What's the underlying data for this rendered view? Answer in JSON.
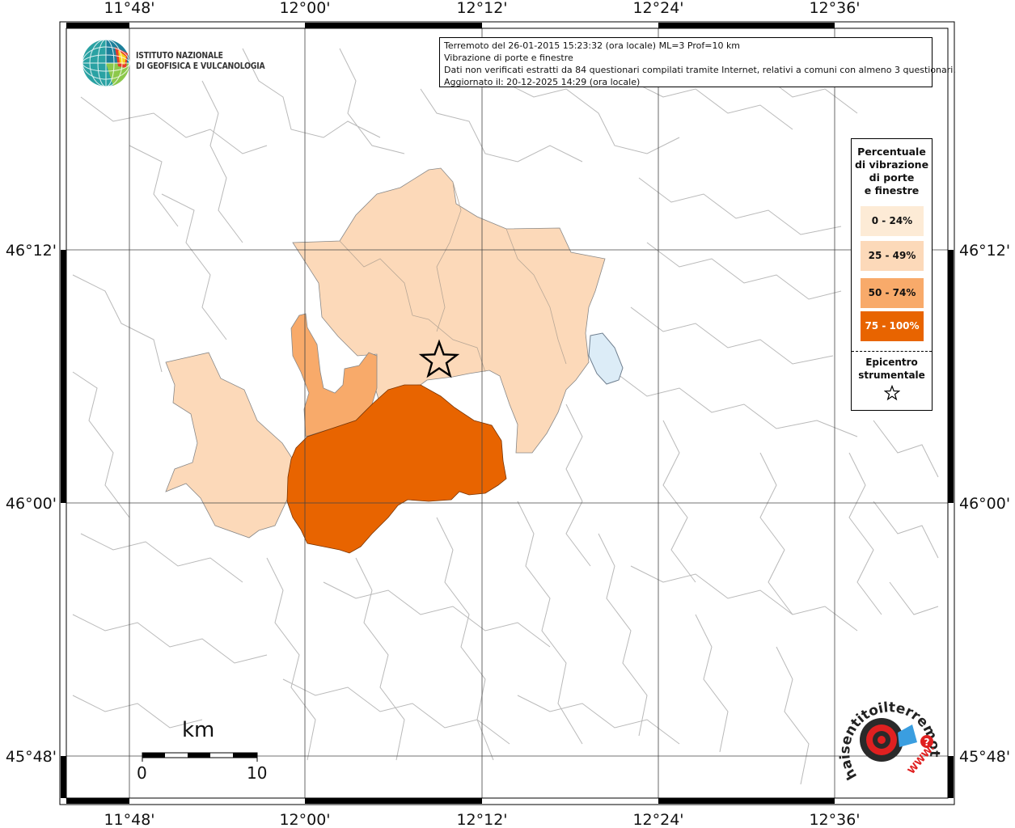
{
  "map": {
    "lon_labels": [
      "11°48'",
      "12°00'",
      "12°12'",
      "12°24'",
      "12°36'"
    ],
    "lat_labels": [
      "46°12'",
      "46°00'",
      "45°48'"
    ]
  },
  "info": {
    "line1": "Terremoto del 26-01-2015 15:23:32 (ora locale) ML=3 Prof=10 km",
    "line2": "Vibrazione di porte e finestre",
    "line3": "Dati non verificati estratti da 84 questionari compilati tramite Internet, relativi a comuni con almeno 3 questionari.",
    "line4": "Aggiornato il: 20-12-2025 14:29 (ora locale)"
  },
  "logo": {
    "line1": "ISTITUTO NAZIONALE",
    "line2": "DI GEOFISICA E VULCANOLOGIA"
  },
  "legend": {
    "title_lines": [
      "Percentuale",
      "di vibrazione",
      "di porte",
      "e finestre"
    ],
    "classes": [
      {
        "label": "0 - 24%",
        "color": "#fdebd6"
      },
      {
        "label": "25 - 49%",
        "color": "#fcd9b9"
      },
      {
        "label": "50 - 74%",
        "color": "#f8aa6a"
      },
      {
        "label": "75 - 100%",
        "color": "#e86400"
      }
    ],
    "epicenter_lines": [
      "Epicentro",
      "strumentale"
    ]
  },
  "scale": {
    "unit": "km",
    "start": "0",
    "end": "10"
  },
  "watermark": {
    "text": "haisentitoilterremoto.it",
    "url_text": "WWW."
  }
}
